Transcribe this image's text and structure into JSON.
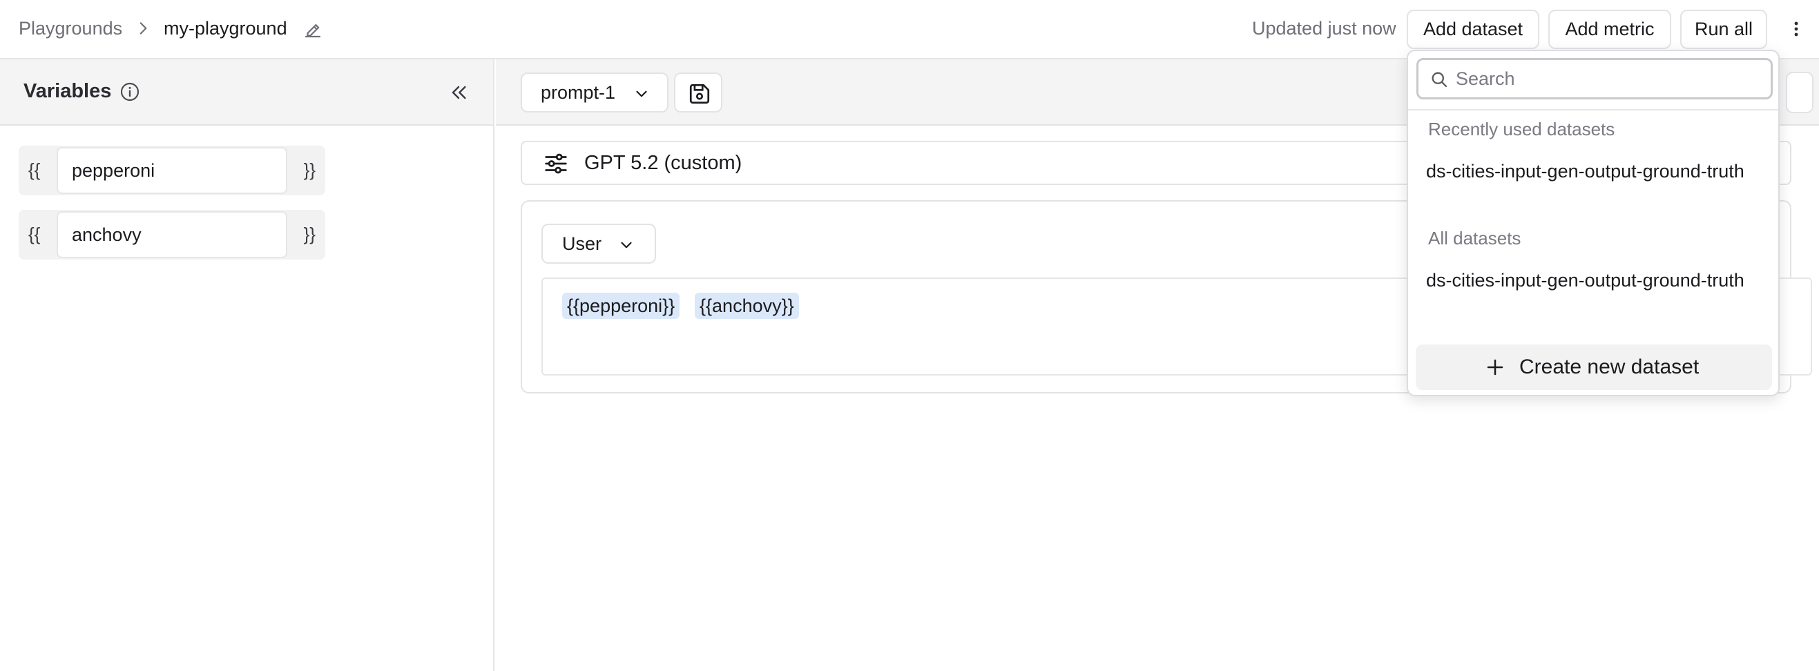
{
  "header": {
    "breadcrumb_root": "Playgrounds",
    "breadcrumb_current": "my-playground",
    "status": "Updated just now",
    "add_dataset_label": "Add dataset",
    "add_metric_label": "Add metric",
    "run_all_label": "Run all"
  },
  "variables_panel": {
    "title": "Variables",
    "open_brace": "{{",
    "close_brace": "}}",
    "items": [
      {
        "value": "pepperoni"
      },
      {
        "value": "anchovy"
      }
    ]
  },
  "prompt": {
    "selected": "prompt-1",
    "model": "GPT 5.2 (custom)",
    "role": "User",
    "tokens": [
      "{{pepperoni}}",
      "{{anchovy}}"
    ]
  },
  "dataset_menu": {
    "search_placeholder": "Search",
    "recent_label": "Recently used datasets",
    "recent_items": [
      "ds-cities-input-gen-output-ground-truth"
    ],
    "all_label": "All datasets",
    "all_items": [
      "ds-cities-input-gen-output-ground-truth"
    ],
    "create_label": "Create new dataset"
  },
  "icons": {
    "breadcrumb_separator": "chevron-right-icon",
    "edit": "pencil-icon",
    "more": "more-vertical-icon",
    "info": "info-icon",
    "collapse": "chevrons-left-icon",
    "save": "save-icon",
    "model_settings": "sliders-icon",
    "search": "search-icon",
    "create": "plus-icon"
  },
  "colors": {
    "token_background": "#dbe8fa",
    "panel_header": "#f4f4f5",
    "border": "#e3e3e6"
  }
}
